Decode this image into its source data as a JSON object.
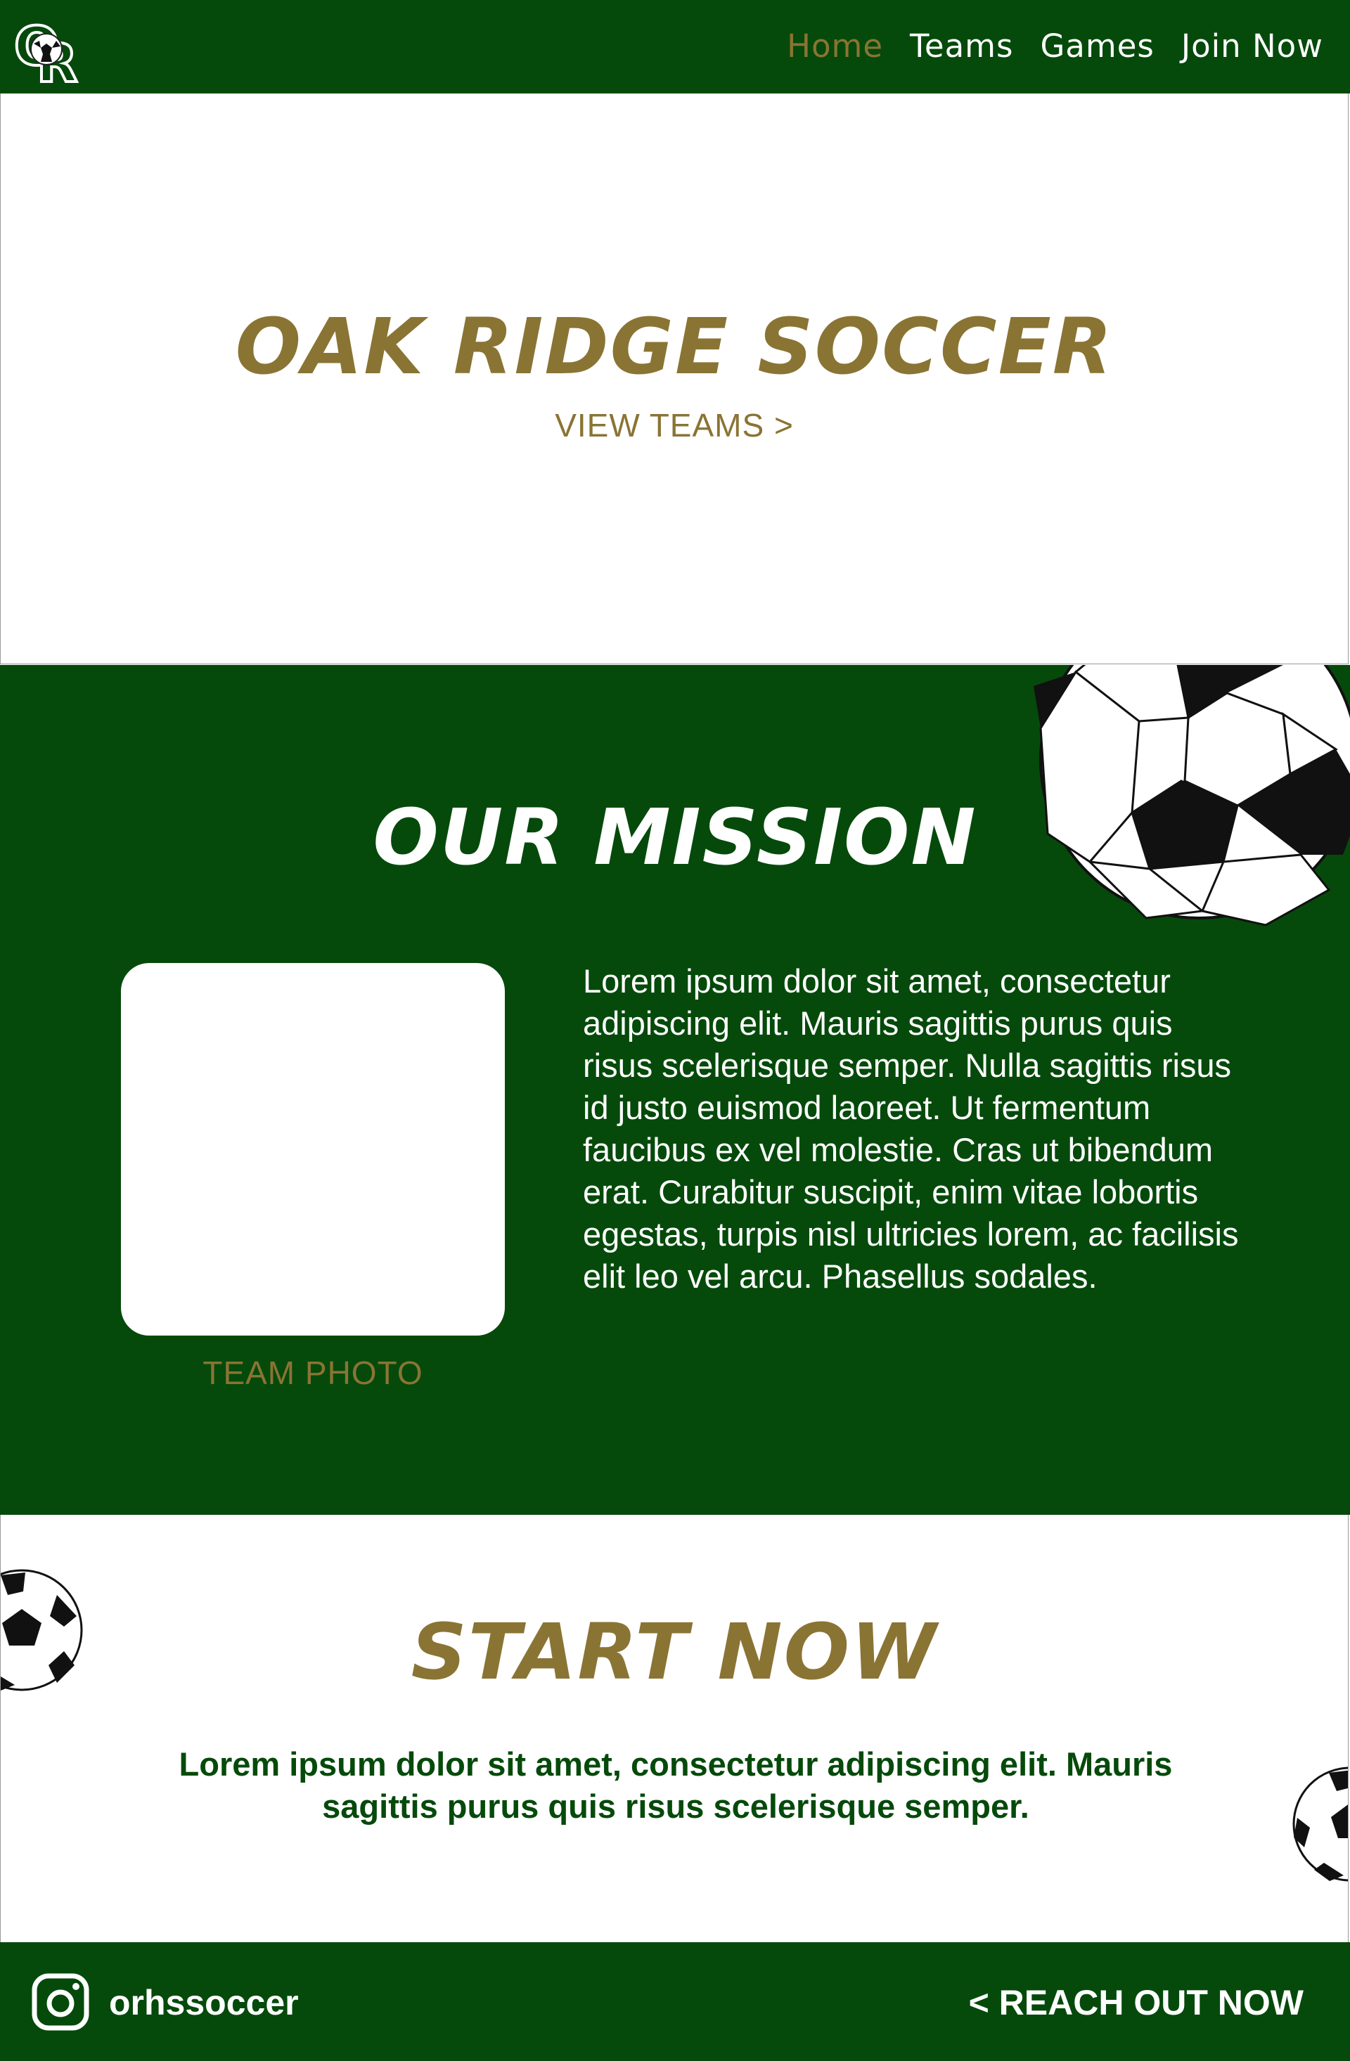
{
  "nav": {
    "logo_text": "OR",
    "links": [
      {
        "label": "Home",
        "active": true
      },
      {
        "label": "Teams",
        "active": false
      },
      {
        "label": "Games",
        "active": false
      },
      {
        "label": "Join Now",
        "active": false
      }
    ]
  },
  "hero": {
    "title": "OAK RIDGE SOCCER",
    "link": "VIEW TEAMS >"
  },
  "mission": {
    "title": "OUR MISSION",
    "photo_caption": "TEAM PHOTO",
    "text": "Lorem ipsum dolor sit amet, consectetur adipiscing elit. Mauris sagittis purus quis risus scelerisque semper. Nulla sagittis risus id justo euismod laoreet. Ut fermentum faucibus ex vel molestie. Cras ut bibendum erat. Curabitur suscipit, enim vitae lobortis egestas, turpis nisl ultricies lorem, ac facilisis elit leo vel arcu. Phasellus sodales."
  },
  "start": {
    "title": "START NOW",
    "text": "Lorem ipsum dolor sit amet, consectetur adipiscing elit. Mauris sagittis purus quis risus scelerisque semper."
  },
  "footer": {
    "instagram_icon": "instagram-icon",
    "handle": "orhssoccer",
    "cta": "< REACH OUT NOW"
  },
  "colors": {
    "brand_green": "#054A0B",
    "brand_gold": "#8A7434",
    "white": "#FFFFFF"
  }
}
